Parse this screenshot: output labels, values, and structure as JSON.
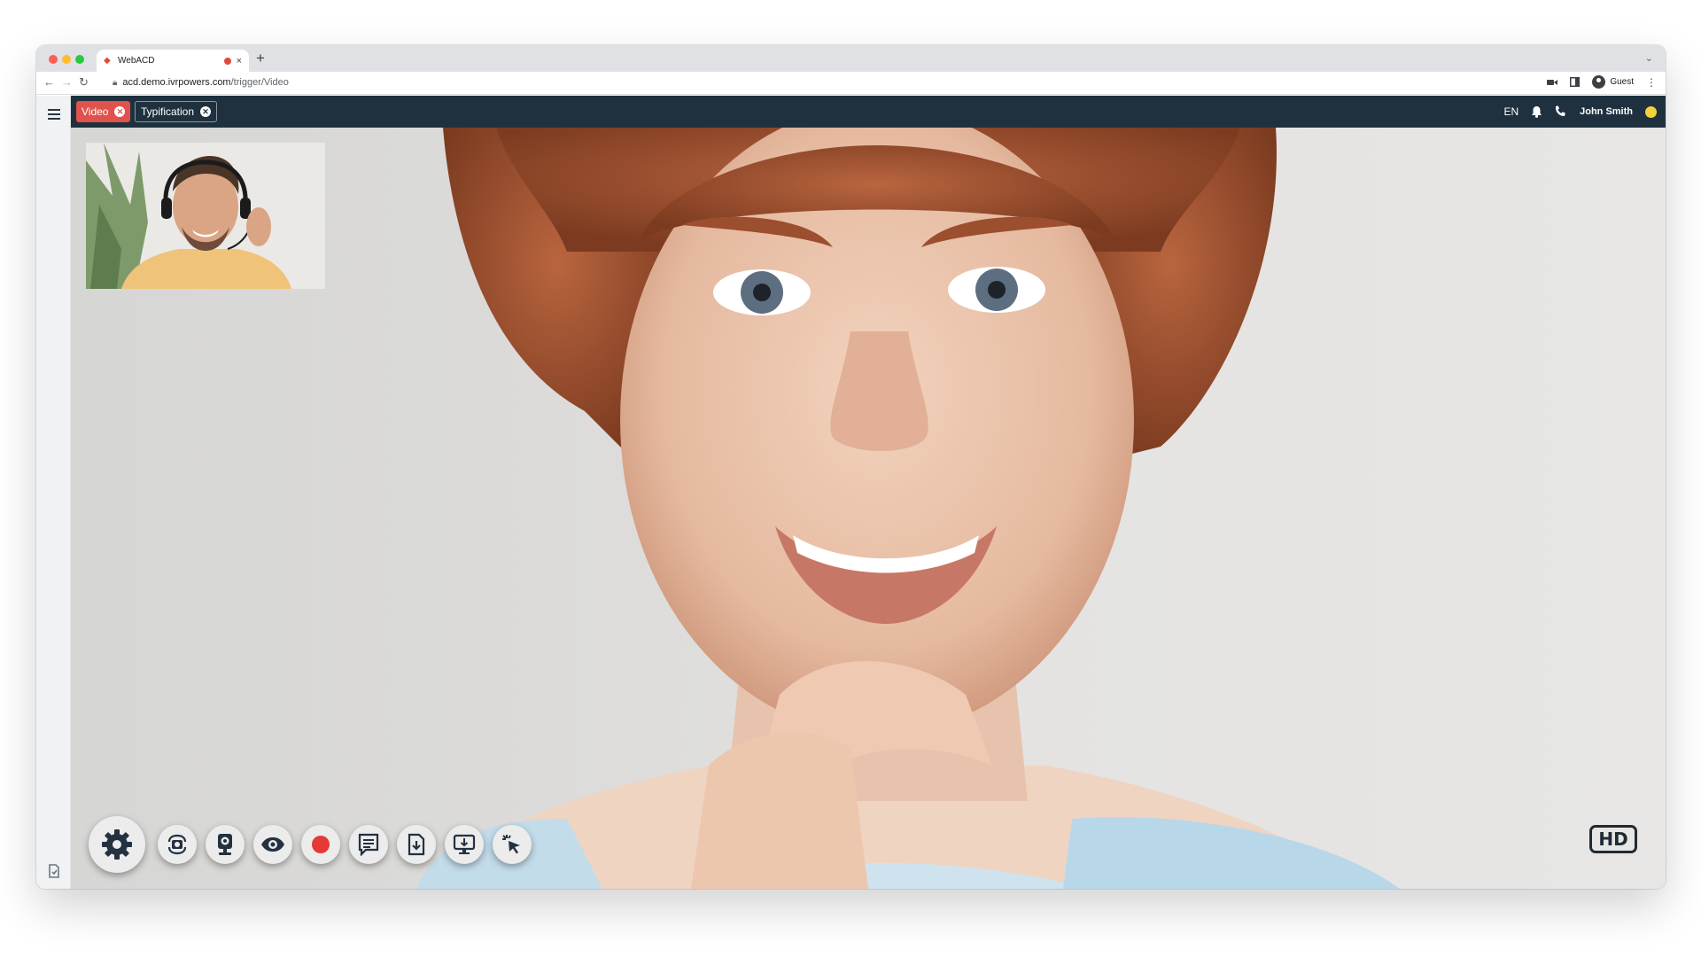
{
  "browser": {
    "tab_title": "WebACD",
    "tab_close": "×",
    "new_tab": "+",
    "url_host": "acd.demo.ivrpowers.com",
    "url_path": "/trigger/Video",
    "profile_label": "Guest"
  },
  "app": {
    "tabs": [
      {
        "label": "Video",
        "active": true
      },
      {
        "label": "Typification",
        "active": false
      }
    ],
    "language": "EN",
    "user_name": "John Smith",
    "status_color": "#f6d13b",
    "accent_color": "#e0534d",
    "header_color": "#1f313e"
  },
  "video": {
    "quality_badge": "HD",
    "controls": [
      {
        "name": "settings-button",
        "icon": "gear-icon"
      },
      {
        "name": "camera-switch-button",
        "icon": "camera-rotate-icon"
      },
      {
        "name": "webcam-button",
        "icon": "webcam-icon"
      },
      {
        "name": "view-button",
        "icon": "eye-icon"
      },
      {
        "name": "record-button",
        "icon": "record-icon",
        "color": "#e53935"
      },
      {
        "name": "notes-button",
        "icon": "message-icon"
      },
      {
        "name": "file-download-button",
        "icon": "file-download-icon"
      },
      {
        "name": "screen-share-button",
        "icon": "monitor-download-icon"
      },
      {
        "name": "remote-pointer-button",
        "icon": "cursor-click-icon"
      }
    ]
  }
}
